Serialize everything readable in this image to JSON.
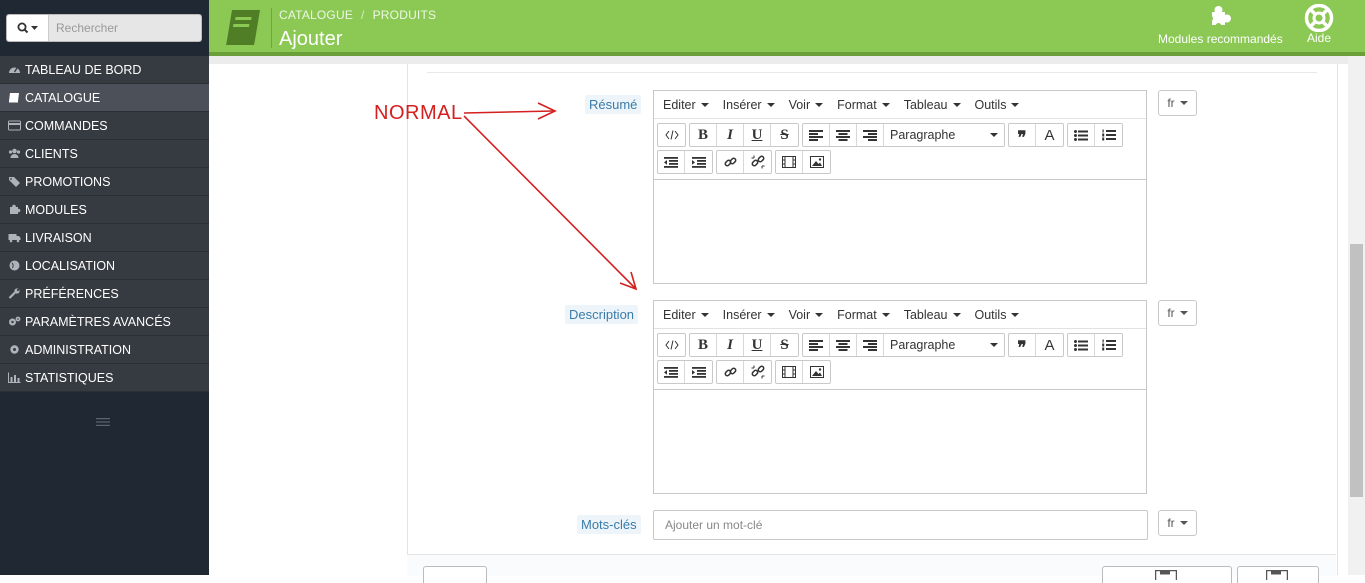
{
  "search": {
    "placeholder": "Rechercher"
  },
  "sidebar": {
    "items": [
      {
        "label": "TABLEAU DE BORD",
        "icon": "dashboard-icon"
      },
      {
        "label": "CATALOGUE",
        "icon": "book-icon",
        "active": true
      },
      {
        "label": "COMMANDES",
        "icon": "credit-card-icon"
      },
      {
        "label": "CLIENTS",
        "icon": "users-icon"
      },
      {
        "label": "PROMOTIONS",
        "icon": "tags-icon"
      },
      {
        "label": "MODULES",
        "icon": "puzzle-icon"
      },
      {
        "label": "LIVRAISON",
        "icon": "truck-icon"
      },
      {
        "label": "LOCALISATION",
        "icon": "globe-icon"
      },
      {
        "label": "PRÉFÉRENCES",
        "icon": "wrench-icon"
      },
      {
        "label": "PARAMÈTRES AVANCÉS",
        "icon": "cogs-icon"
      },
      {
        "label": "ADMINISTRATION",
        "icon": "gear-icon"
      },
      {
        "label": "STATISTIQUES",
        "icon": "bar-chart-icon"
      }
    ]
  },
  "header": {
    "breadcrumb": [
      "CATALOGUE",
      "PRODUITS"
    ],
    "breadcrumb_sep": "/",
    "title": "Ajouter",
    "modules_label": "Modules recommandés",
    "help_label": "Aide"
  },
  "form": {
    "summary_label": "Résumé",
    "description_label": "Description",
    "keywords_label": "Mots-clés",
    "keywords_placeholder": "Ajouter un mot-clé",
    "lang": "fr"
  },
  "editor": {
    "menus": [
      "Editer",
      "Insérer",
      "Voir",
      "Format",
      "Tableau",
      "Outils"
    ],
    "format_select": "Paragraphe"
  },
  "annotation": {
    "text": "NORMAL",
    "color": "#d32020"
  },
  "colors": {
    "header": "#8bc954",
    "sidebar": "#363a41",
    "label": "#3b7ba8"
  }
}
